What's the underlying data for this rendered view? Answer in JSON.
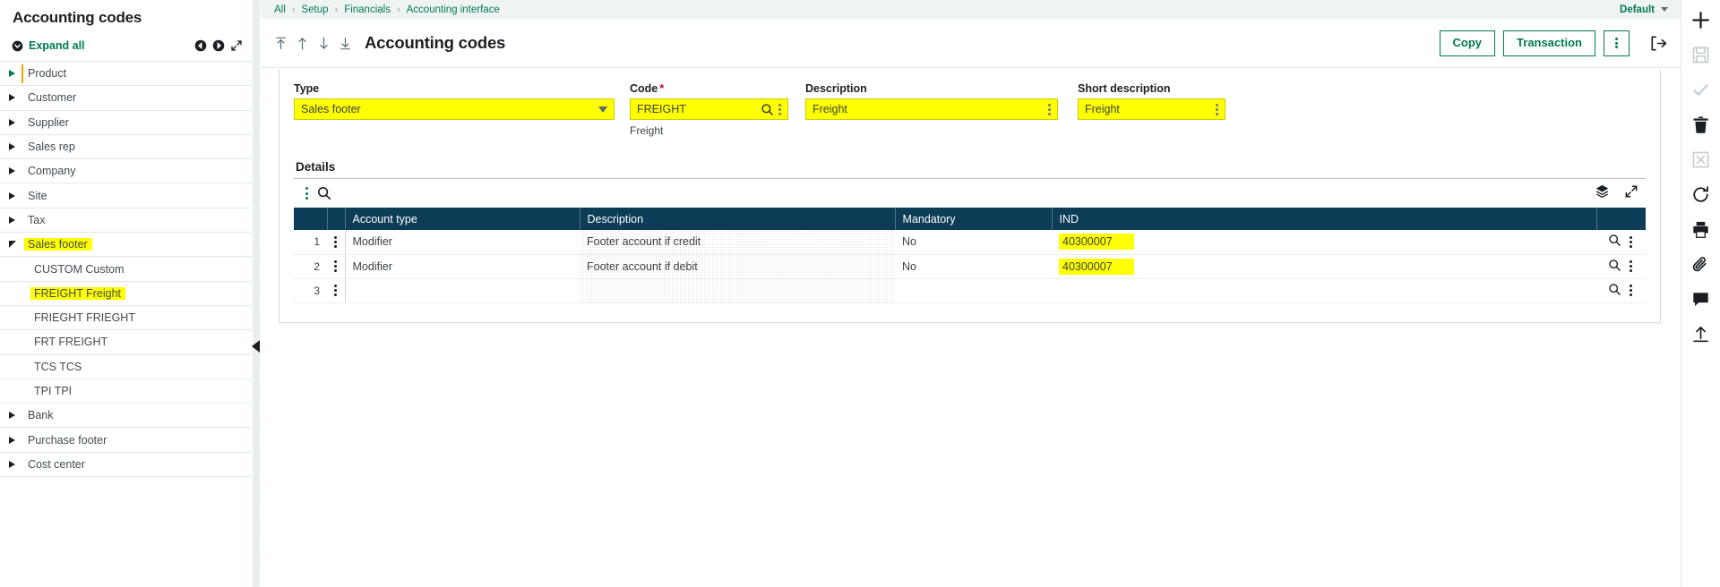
{
  "sidebar": {
    "title": "Accounting codes",
    "expand_all_label": "Expand all",
    "icons": {
      "expand_toggle": "chevron-circle-down-icon",
      "prev": "nav-prev-icon",
      "next": "nav-next-icon",
      "fullscreen": "expand-diagonal-icon"
    },
    "items": [
      {
        "label": "Product",
        "level": 1,
        "state": "collapsed",
        "highlight": false,
        "accent": true
      },
      {
        "label": "Customer",
        "level": 1,
        "state": "collapsed",
        "highlight": false,
        "accent": false
      },
      {
        "label": "Supplier",
        "level": 1,
        "state": "collapsed",
        "highlight": false,
        "accent": false
      },
      {
        "label": "Sales rep",
        "level": 1,
        "state": "collapsed",
        "highlight": false,
        "accent": false
      },
      {
        "label": "Company",
        "level": 1,
        "state": "collapsed",
        "highlight": false,
        "accent": false
      },
      {
        "label": "Site",
        "level": 1,
        "state": "collapsed",
        "highlight": false,
        "accent": false
      },
      {
        "label": "Tax",
        "level": 1,
        "state": "collapsed",
        "highlight": false,
        "accent": false
      },
      {
        "label": "Sales footer",
        "level": 1,
        "state": "expanded",
        "highlight": true,
        "accent": false
      },
      {
        "label": "CUSTOM Custom",
        "level": 2,
        "state": "leaf",
        "highlight": false,
        "accent": false
      },
      {
        "label": "FREIGHT Freight",
        "level": 2,
        "state": "leaf",
        "highlight": true,
        "accent": false
      },
      {
        "label": "FRIEGHT FRIEGHT",
        "level": 2,
        "state": "leaf",
        "highlight": false,
        "accent": false
      },
      {
        "label": "FRT FREIGHT",
        "level": 2,
        "state": "leaf",
        "highlight": false,
        "accent": false
      },
      {
        "label": "TCS TCS",
        "level": 2,
        "state": "leaf",
        "highlight": false,
        "accent": false
      },
      {
        "label": "TPI TPI",
        "level": 2,
        "state": "leaf",
        "highlight": false,
        "accent": false
      },
      {
        "label": "Bank",
        "level": 1,
        "state": "collapsed",
        "highlight": false,
        "accent": false
      },
      {
        "label": "Purchase footer",
        "level": 1,
        "state": "collapsed",
        "highlight": false,
        "accent": false
      },
      {
        "label": "Cost center",
        "level": 1,
        "state": "collapsed",
        "highlight": false,
        "accent": false
      }
    ]
  },
  "breadcrumb": {
    "items": [
      "All",
      "Setup",
      "Financials",
      "Accounting interface"
    ],
    "separator": "›",
    "profile_label": "Default"
  },
  "header": {
    "title": "Accounting codes",
    "nav_icons": [
      "first-record-icon",
      "previous-record-icon",
      "next-record-icon",
      "last-record-icon"
    ],
    "copy_label": "Copy",
    "transaction_label": "Transaction",
    "kebab_icon": "more-options-icon",
    "logout_icon": "logout-icon"
  },
  "form": {
    "type": {
      "label": "Type",
      "value": "Sales footer",
      "placeholder": "Select a type",
      "control": "dropdown"
    },
    "code": {
      "label": "Code",
      "required_marker": "*",
      "value": "FREIGHT",
      "placeholder": "Code",
      "hint": "Freight",
      "control": "lookup"
    },
    "description": {
      "label": "Description",
      "value": "Freight",
      "placeholder": "Description",
      "control": "text"
    },
    "short_description": {
      "label": "Short description",
      "value": "Freight",
      "placeholder": "Short description",
      "control": "text"
    }
  },
  "details": {
    "title": "Details",
    "toolbar": {
      "kebab_icon": "grid-actions-icon",
      "search_icon": "search-icon",
      "layers_icon": "layers-icon",
      "expand_icon": "expand-diagonal-icon"
    },
    "columns": [
      "Account type",
      "Description",
      "Mandatory",
      "IND"
    ],
    "rows": [
      {
        "num": "1",
        "account_type": "Modifier",
        "description": "Footer account if credit",
        "mandatory": "No",
        "ind": "40300007",
        "ind_highlighted": true
      },
      {
        "num": "2",
        "account_type": "Modifier",
        "description": "Footer account if debit",
        "mandatory": "No",
        "ind": "40300007",
        "ind_highlighted": true
      },
      {
        "num": "3",
        "account_type": "",
        "description": "",
        "mandatory": "",
        "ind": "",
        "ind_highlighted": false
      }
    ],
    "row_icons": [
      "row-lookup-icon",
      "row-actions-icon"
    ]
  },
  "rail": {
    "items": [
      {
        "icon": "add-icon",
        "name": "add-button",
        "muted": false
      },
      {
        "icon": "save-icon",
        "name": "save-button",
        "muted": true
      },
      {
        "icon": "check-icon",
        "name": "validate-button",
        "muted": true
      },
      {
        "icon": "trash-icon",
        "name": "delete-button",
        "muted": false
      },
      {
        "icon": "cancel-icon",
        "name": "cancel-button",
        "muted": true
      },
      {
        "icon": "refresh-icon",
        "name": "refresh-button",
        "muted": false
      },
      {
        "icon": "print-icon",
        "name": "print-button",
        "muted": false
      },
      {
        "icon": "attach-icon",
        "name": "attachment-button",
        "muted": false
      },
      {
        "icon": "comment-icon",
        "name": "comment-button",
        "muted": false
      },
      {
        "icon": "share-icon",
        "name": "share-button",
        "muted": false
      }
    ]
  },
  "colors": {
    "brand_green": "#007a53",
    "highlight_yellow": "#ffff00",
    "grid_header": "#0d3c56",
    "required_red": "#cc0033",
    "accent_orange": "#f0a500"
  }
}
